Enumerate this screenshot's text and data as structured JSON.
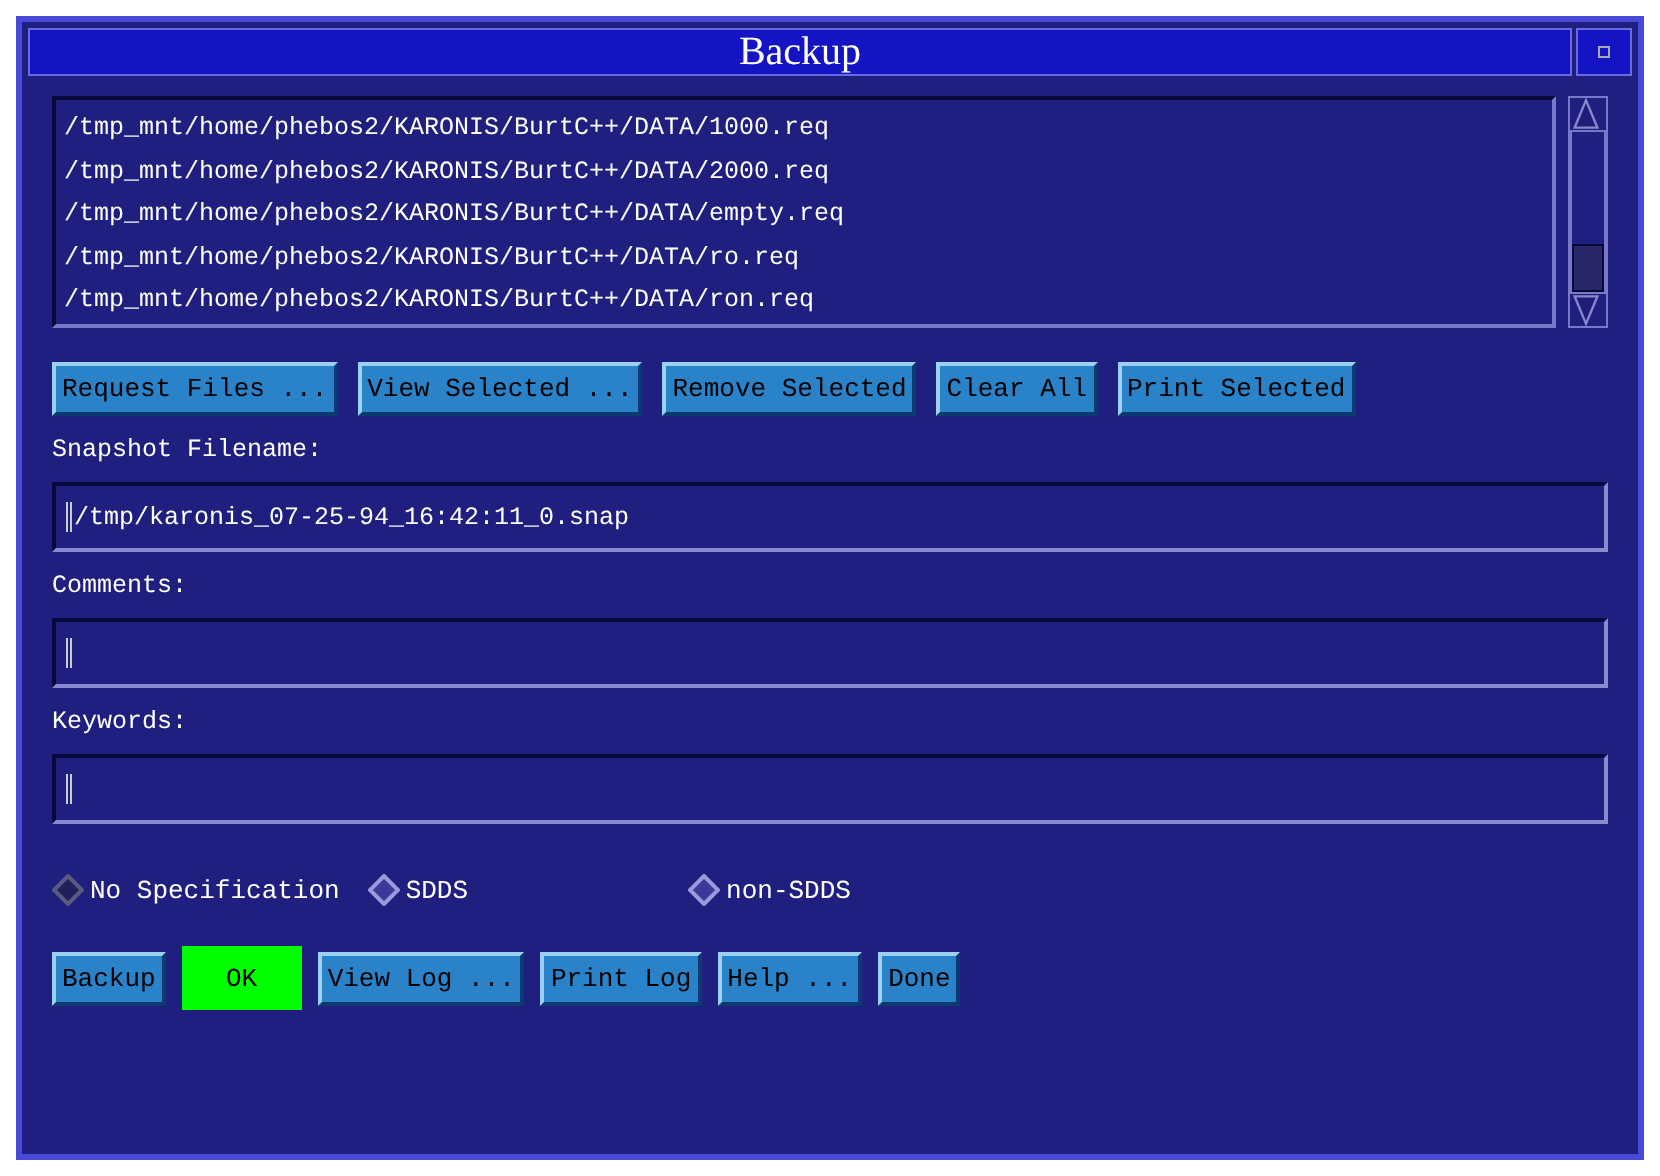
{
  "window": {
    "title": "Backup"
  },
  "file_list": {
    "items": [
      {
        "text": "/tmp_mnt/home/phebos2/KARONIS/BurtC++/DATA/1000.req",
        "selected": false
      },
      {
        "text": "/tmp_mnt/home/phebos2/KARONIS/BurtC++/DATA/2000.req",
        "selected": false
      },
      {
        "text": "/tmp_mnt/home/phebos2/KARONIS/BurtC++/DATA/empty.req",
        "selected": false
      },
      {
        "text": "/tmp_mnt/home/phebos2/KARONIS/BurtC++/DATA/ro.req",
        "selected": false
      },
      {
        "text": "/tmp_mnt/home/phebos2/KARONIS/BurtC++/DATA/ron.req",
        "selected": false
      }
    ]
  },
  "list_buttons": [
    "Request Files ...",
    "View Selected ...",
    "Remove Selected",
    "Clear All",
    "Print Selected"
  ],
  "fields": [
    {
      "label": "Snapshot Filename:",
      "value": "/tmp/karonis_07-25-94_16:42:11_0.snap"
    },
    {
      "label": "Comments:"
    },
    {
      "label": "Keywords:"
    }
  ],
  "format_options": [
    {
      "label": "No Specification",
      "selected": true
    },
    {
      "label": "SDDS",
      "selected": false
    },
    {
      "label": "non-SDDS",
      "selected": false
    }
  ],
  "actions": [
    {
      "kind": "button",
      "label": "Backup"
    },
    {
      "kind": "status",
      "label": "OK"
    },
    {
      "kind": "button",
      "label": "View Log ..."
    },
    {
      "kind": "button",
      "label": "Print Log"
    },
    {
      "kind": "button",
      "label": "Help ..."
    },
    {
      "kind": "button",
      "label": "Done"
    }
  ]
}
